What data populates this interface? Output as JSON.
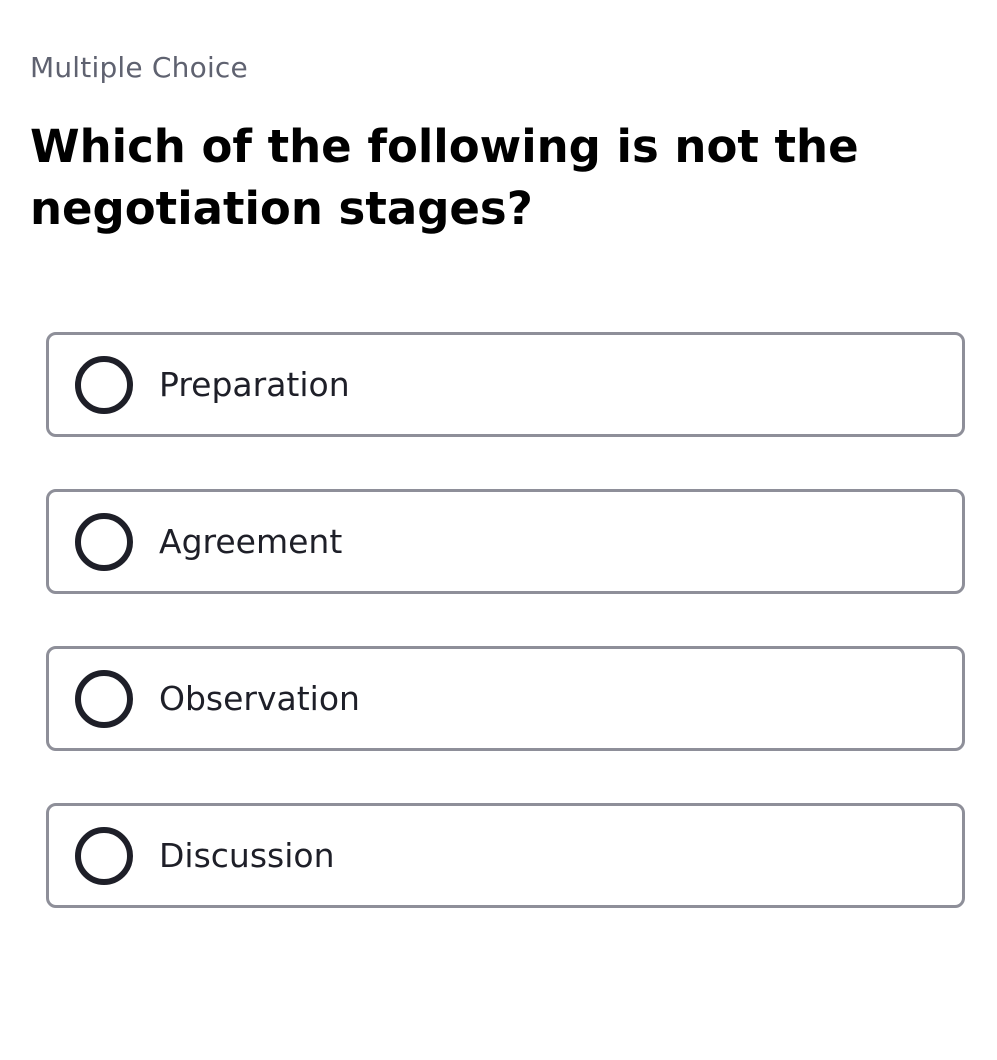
{
  "question": {
    "type_label": "Multiple Choice",
    "text": "Which of the following is not the negotiation stages?"
  },
  "options": [
    {
      "label": "Preparation",
      "selected": false
    },
    {
      "label": "Agreement",
      "selected": false
    },
    {
      "label": "Observation",
      "selected": false
    },
    {
      "label": "Discussion",
      "selected": false
    }
  ],
  "colors": {
    "type_label": "#5f6270",
    "option_border": "#8e8f99",
    "radio_ring": "#1e1f28",
    "background": "#ffffff"
  },
  "icons": {
    "radio": "radio-unchecked-icon"
  }
}
